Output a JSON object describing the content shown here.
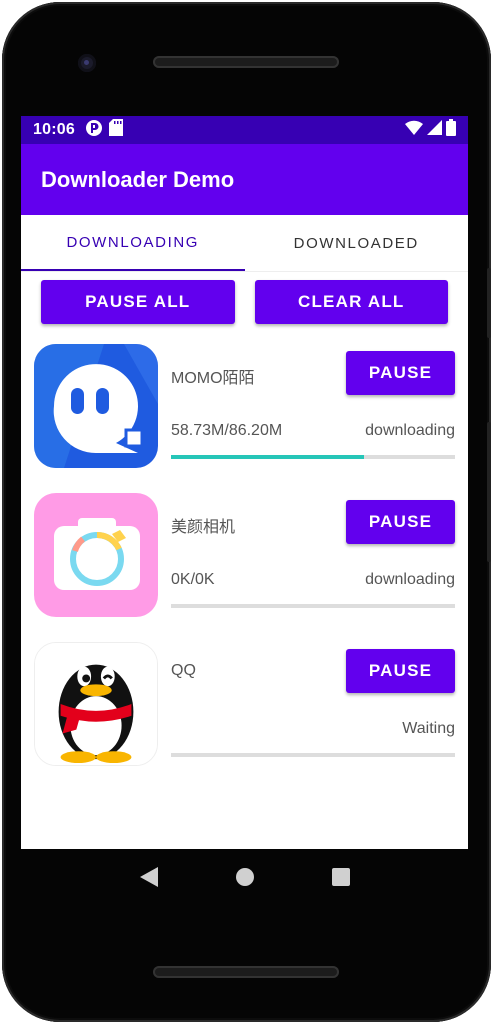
{
  "status_bar": {
    "time": "10:06",
    "left_icons": [
      "play-store-icon",
      "sd-card-icon"
    ],
    "right_icons": [
      "wifi-icon",
      "signal-icon",
      "battery-icon"
    ]
  },
  "app_bar": {
    "title": "Downloader Demo"
  },
  "tabs": [
    {
      "label": "DOWNLOADING",
      "active": true
    },
    {
      "label": "DOWNLOADED",
      "active": false
    }
  ],
  "actions": {
    "pause_all": "PAUSE ALL",
    "clear_all": "CLEAR ALL"
  },
  "downloads": [
    {
      "name": "MOMO陌陌",
      "button": "PAUSE",
      "size": "58.73M/86.20M",
      "status": "downloading",
      "progress": 0.68,
      "icon": "momo-app-icon"
    },
    {
      "name": "美颜相机",
      "button": "PAUSE",
      "size": "0K/0K",
      "status": "downloading",
      "progress": 0,
      "icon": "beauty-camera-app-icon"
    },
    {
      "name": "QQ",
      "button": "PAUSE",
      "size": "",
      "status": "Waiting",
      "progress": 0,
      "icon": "qq-penguin-app-icon"
    }
  ],
  "nav_bar": {
    "buttons": [
      "back-icon",
      "home-icon",
      "recents-icon"
    ]
  },
  "colors": {
    "primary": "#6200ee",
    "primary_dark": "#3700b3",
    "progress": "#26c6b8",
    "track": "#dddddd"
  }
}
